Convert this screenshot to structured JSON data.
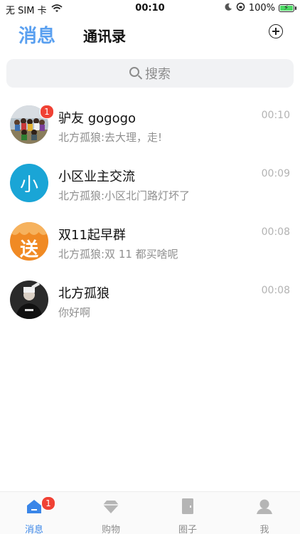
{
  "status_bar": {
    "carrier": "无 SIM 卡",
    "time": "00:10",
    "battery": "100%"
  },
  "header": {
    "tab_messages": "消息",
    "tab_contacts": "通讯录",
    "add_icon": "plus-circle-icon"
  },
  "search": {
    "placeholder": "搜索",
    "icon": "search-icon"
  },
  "conversations": [
    {
      "title": "驴友 gogogo",
      "last_message": "北方孤狼:去大理，走!",
      "time": "00:10",
      "unread": "1"
    },
    {
      "title": "小区业主交流",
      "last_message": "北方孤狼:小区北门路灯坏了",
      "time": "00:09",
      "avatar_text": "小"
    },
    {
      "title": "双11起早群",
      "last_message": "北方孤狼:双 11 都买啥呢",
      "time": "00:08",
      "avatar_text": "送"
    },
    {
      "title": "北方孤狼",
      "last_message": "你好啊",
      "time": "00:08"
    }
  ],
  "tabbar": {
    "tabs": [
      {
        "label": "消息",
        "icon": "message-house-icon",
        "badge": "1",
        "active": true
      },
      {
        "label": "购物",
        "icon": "diamond-icon"
      },
      {
        "label": "圈子",
        "icon": "door-icon"
      },
      {
        "label": "我",
        "icon": "person-icon"
      }
    ]
  },
  "colors": {
    "accent": "#3a86e8",
    "badge": "#f04134",
    "avatar_cyan": "#1aa5d6",
    "avatar_orange": "#f08a24"
  }
}
